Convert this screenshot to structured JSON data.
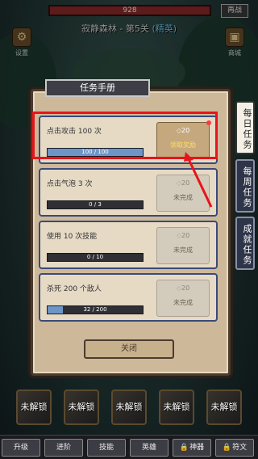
{
  "hud": {
    "hp_value": "928",
    "restart_label": "再战",
    "stage_title": "寂静森林 - 第5关",
    "stage_tag": "(精英)"
  },
  "side_icons": [
    {
      "label": "设置",
      "icon": "gear-icon"
    },
    {
      "label": "商城",
      "icon": "chest-icon"
    }
  ],
  "panel": {
    "title": "任务手册",
    "close_label": "关闭",
    "quests": [
      {
        "label": "点击攻击 100 次",
        "progress": "100 / 100",
        "fraction": 1.0,
        "gems": "20",
        "status": "领取奖励",
        "claimable": true
      },
      {
        "label": "点击气泡 3 次",
        "progress": "0 / 3",
        "fraction": 0.0,
        "gems": "20",
        "status": "未完成",
        "claimable": false
      },
      {
        "label": "使用 10 次技能",
        "progress": "0 / 10",
        "fraction": 0.0,
        "gems": "20",
        "status": "未完成",
        "claimable": false
      },
      {
        "label": "杀死 200 个敌人",
        "progress": "32 / 200",
        "fraction": 0.16,
        "gems": "20",
        "status": "未完成",
        "claimable": false
      }
    ]
  },
  "tabs": [
    {
      "label": "每日任务",
      "active": true
    },
    {
      "label": "每周任务",
      "active": false
    },
    {
      "label": "成就任务",
      "active": false
    }
  ],
  "skill_slots": [
    "未解锁",
    "未解锁",
    "未解锁",
    "未解锁",
    "未解锁"
  ],
  "bottom_nav": [
    {
      "label": "升级",
      "locked": false
    },
    {
      "label": "进阶",
      "locked": false
    },
    {
      "label": "技能",
      "locked": false
    },
    {
      "label": "英雄",
      "locked": false
    },
    {
      "label": "神器",
      "locked": true
    },
    {
      "label": "符文",
      "locked": true
    }
  ],
  "colors": {
    "highlight": "#e8141a",
    "progress_fill": "#6d95c8",
    "claim_text": "#ffe15a"
  }
}
